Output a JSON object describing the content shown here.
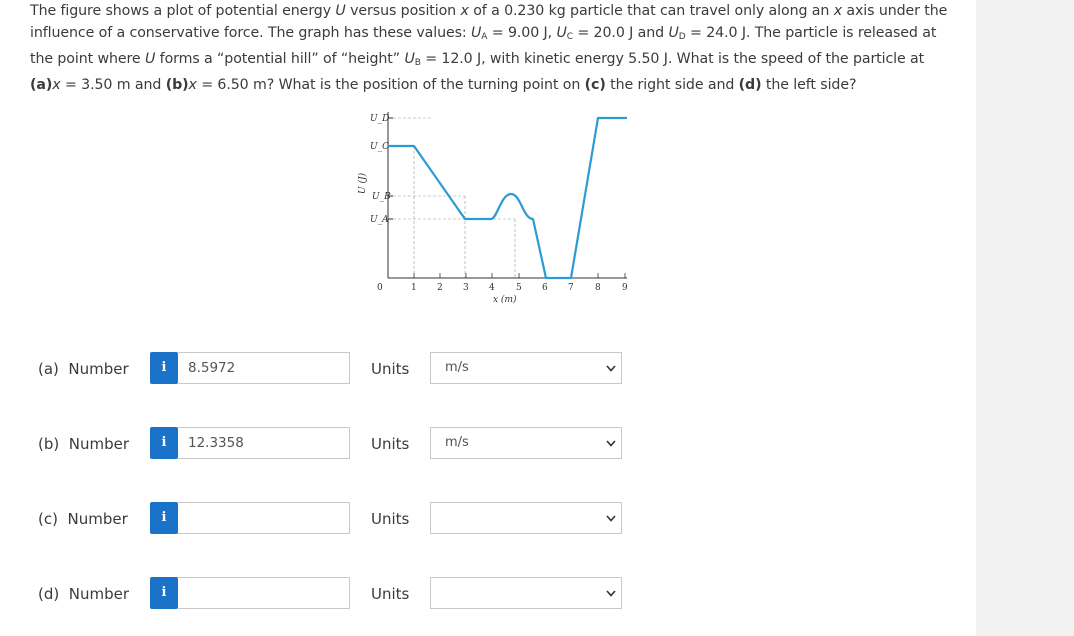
{
  "question": {
    "p1": "The figure shows a plot of potential energy ",
    "U": "U",
    "p2": " versus position ",
    "x": "x",
    "p3": " of a 0.230 kg particle that can travel only along an ",
    "x2": "x",
    "p4": " axis under the influence of a conservative force. The graph has these values: ",
    "UA": "U",
    "A": "A",
    "p5": " = 9.00 J, ",
    "UC": "U",
    "C": "C",
    "p6": " = 20.0 J and ",
    "UD": "U",
    "D": "D",
    "p7": " = 24.0 J. The particle is released at the point where ",
    "U2": "U",
    "p8": " forms a “potential hill” of “height” ",
    "UB": "U",
    "B": "B",
    "p9": " = 12.0 J, with kinetic energy 5.50 J. What is the speed of the particle at ",
    "a": "(a)",
    "xa": "x",
    "p10": " = 3.50 m and ",
    "b": "(b)",
    "xb": "x",
    "p11": " = 6.50 m? What is the position of the turning point on ",
    "c": "(c)",
    "p12": " the right side and ",
    "d": "(d)",
    "p13": " the left side?"
  },
  "figure": {
    "ylabel": "U (J)",
    "xlabel": "x (m)",
    "ytick_labels": [
      "U_D",
      "U_C",
      "U_B",
      "U_A",
      "0"
    ],
    "xtick_labels": [
      "1",
      "2",
      "3",
      "4",
      "5",
      "6",
      "7",
      "8",
      "9"
    ],
    "curve_color": "#2b9bd3"
  },
  "answers": [
    {
      "label": "(a)  Number",
      "value": "8.5972",
      "units_label": "Units",
      "unit": "m/s"
    },
    {
      "label": "(b)  Number",
      "value": "12.3358",
      "units_label": "Units",
      "unit": "m/s"
    },
    {
      "label": "(c)  Number",
      "value": "",
      "units_label": "Units",
      "unit": ""
    },
    {
      "label": "(d)  Number",
      "value": "",
      "units_label": "Units",
      "unit": ""
    }
  ],
  "info_icon": "i",
  "colors": {
    "info_button": "#1a73c9"
  }
}
